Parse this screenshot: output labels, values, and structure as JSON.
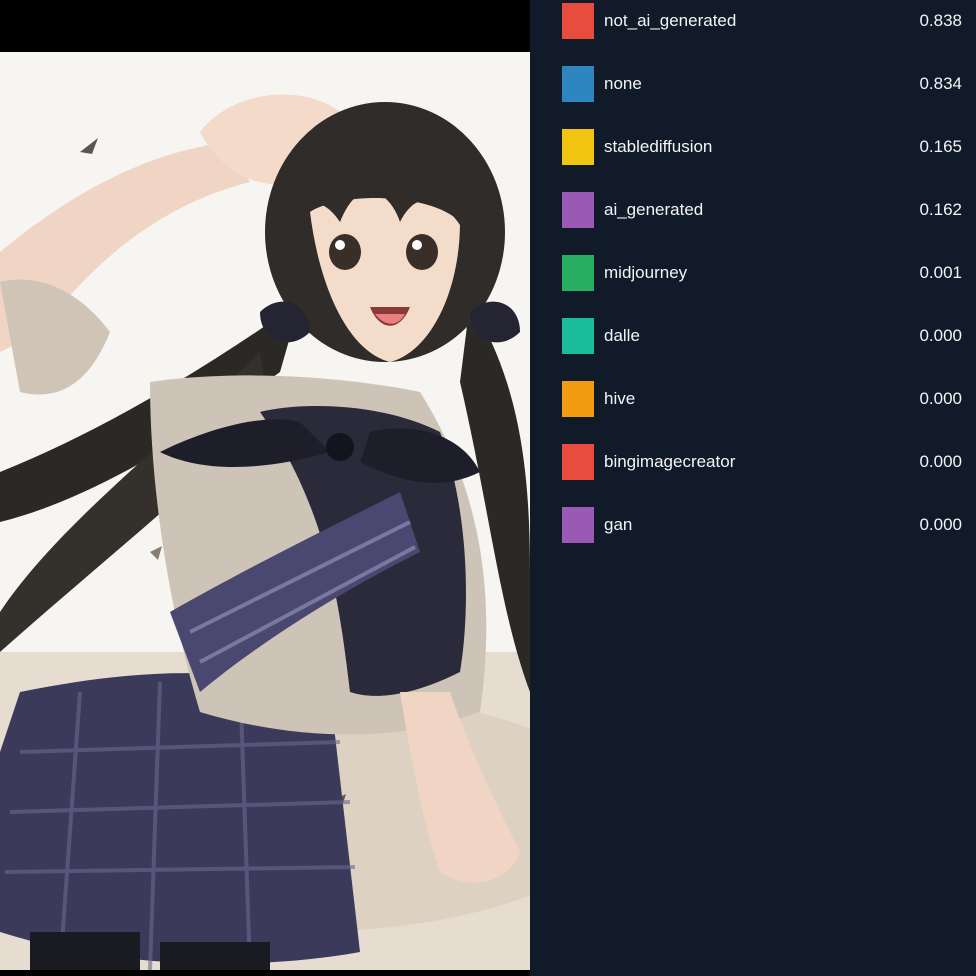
{
  "image": {
    "icon": "anime-girl-illustration"
  },
  "results": [
    {
      "label": "not_ai_generated",
      "score": "0.838",
      "color": "#e74c3c"
    },
    {
      "label": "none",
      "score": "0.834",
      "color": "#2e86c1"
    },
    {
      "label": "stablediffusion",
      "score": "0.165",
      "color": "#f1c40f"
    },
    {
      "label": "ai_generated",
      "score": "0.162",
      "color": "#9b59b6"
    },
    {
      "label": "midjourney",
      "score": "0.001",
      "color": "#27ae60"
    },
    {
      "label": "dalle",
      "score": "0.000",
      "color": "#1abc9c"
    },
    {
      "label": "hive",
      "score": "0.000",
      "color": "#f39c12"
    },
    {
      "label": "bingimagecreator",
      "score": "0.000",
      "color": "#e74c3c"
    },
    {
      "label": "gan",
      "score": "0.000",
      "color": "#9b59b6"
    }
  ]
}
